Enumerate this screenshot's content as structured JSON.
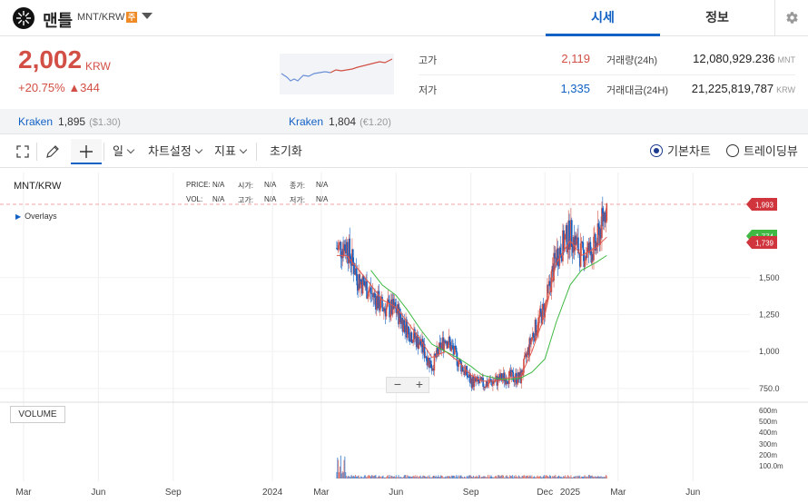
{
  "header": {
    "coin_name": "맨틀",
    "pair": "MNT/KRW",
    "warning_badge": "주",
    "tabs": [
      {
        "label": "시세",
        "active": true
      },
      {
        "label": "정보",
        "active": false
      }
    ]
  },
  "price": {
    "current": "2,002",
    "unit": "KRW",
    "change_pct": "+20.75%",
    "change_abs": "▲344"
  },
  "stats": {
    "high_label": "고가",
    "high_value": "2,119",
    "low_label": "저가",
    "low_value": "1,335",
    "volume_label": "거래량(24h)",
    "volume_value": "12,080,929.236",
    "volume_unit": "MNT",
    "amount_label": "거래대금(24H)",
    "amount_value": "21,225,819,787",
    "amount_unit": "KRW"
  },
  "kraken": [
    {
      "name": "Kraken",
      "value": "1,895",
      "sub": "($1.30)"
    },
    {
      "name": "Kraken",
      "value": "1,804",
      "sub": "(€1.20)"
    }
  ],
  "toolbar": {
    "interval": "일",
    "chart_settings": "차트설정",
    "indicators": "지표",
    "reset": "초기화",
    "basic_chart": "기본차트",
    "trading_view": "트레이딩뷰"
  },
  "chart": {
    "pair": "MNT/KRW",
    "overlays": "Overlays",
    "legend": {
      "price": "PRICE:",
      "vol": "VOL:",
      "open": "시가:",
      "high": "고가:",
      "close": "종가:",
      "low": "저가:",
      "na": "N/A"
    },
    "volume_label": "VOLUME",
    "zoom_out": "−",
    "zoom_in": "+",
    "price_tag_last": "1,993",
    "price_tag_ma": "1,774",
    "price_tag_low": "1,739",
    "y_ticks": [
      "1,500",
      "1,250",
      "1,000",
      "750.0"
    ],
    "vol_ticks": [
      "600m",
      "500m",
      "400m",
      "300m",
      "200m",
      "100.0m"
    ],
    "x_ticks": [
      "Mar",
      "Jun",
      "Sep",
      "2024",
      "Mar",
      "Jun",
      "Sep",
      "Dec",
      "2025",
      "Mar",
      "Jun"
    ],
    "colors": {
      "up": "#d24f45",
      "down": "#1261c4",
      "ma_short": "#e05a4f",
      "ma_long": "#3fb844",
      "accent": "#1261c4"
    }
  },
  "chart_data": {
    "type": "candlestick",
    "ylim": [
      700,
      2150
    ],
    "series": [
      {
        "name": "close",
        "x": [
          "2024-03-20",
          "2024-04-01",
          "2024-04-15",
          "2024-05-01",
          "2024-05-15",
          "2024-06-01",
          "2024-06-15",
          "2024-07-01",
          "2024-07-15",
          "2024-08-01",
          "2024-08-15",
          "2024-09-01",
          "2024-09-15",
          "2024-10-01",
          "2024-10-15",
          "2024-11-01",
          "2024-11-15",
          "2024-12-01",
          "2024-12-15",
          "2025-01-01",
          "2025-01-15",
          "2025-02-01",
          "2025-02-15"
        ],
        "values": [
          1700,
          1720,
          1500,
          1400,
          1300,
          1280,
          1150,
          1050,
          900,
          1100,
          950,
          800,
          780,
          800,
          830,
          820,
          1100,
          1300,
          1650,
          1800,
          1650,
          1700,
          1993
        ]
      },
      {
        "name": "MA short",
        "values": [
          1650,
          1650,
          1560,
          1450,
          1350,
          1300,
          1200,
          1080,
          960,
          1000,
          940,
          840,
          800,
          800,
          820,
          830,
          1000,
          1250,
          1600,
          1750,
          1650,
          1700,
          1774
        ]
      },
      {
        "name": "MA long",
        "values": [
          null,
          null,
          null,
          1550,
          1450,
          1380,
          1280,
          1150,
          1050,
          1000,
          960,
          900,
          840,
          820,
          810,
          820,
          860,
          950,
          1200,
          1450,
          1550,
          1600,
          1650
        ]
      }
    ]
  }
}
